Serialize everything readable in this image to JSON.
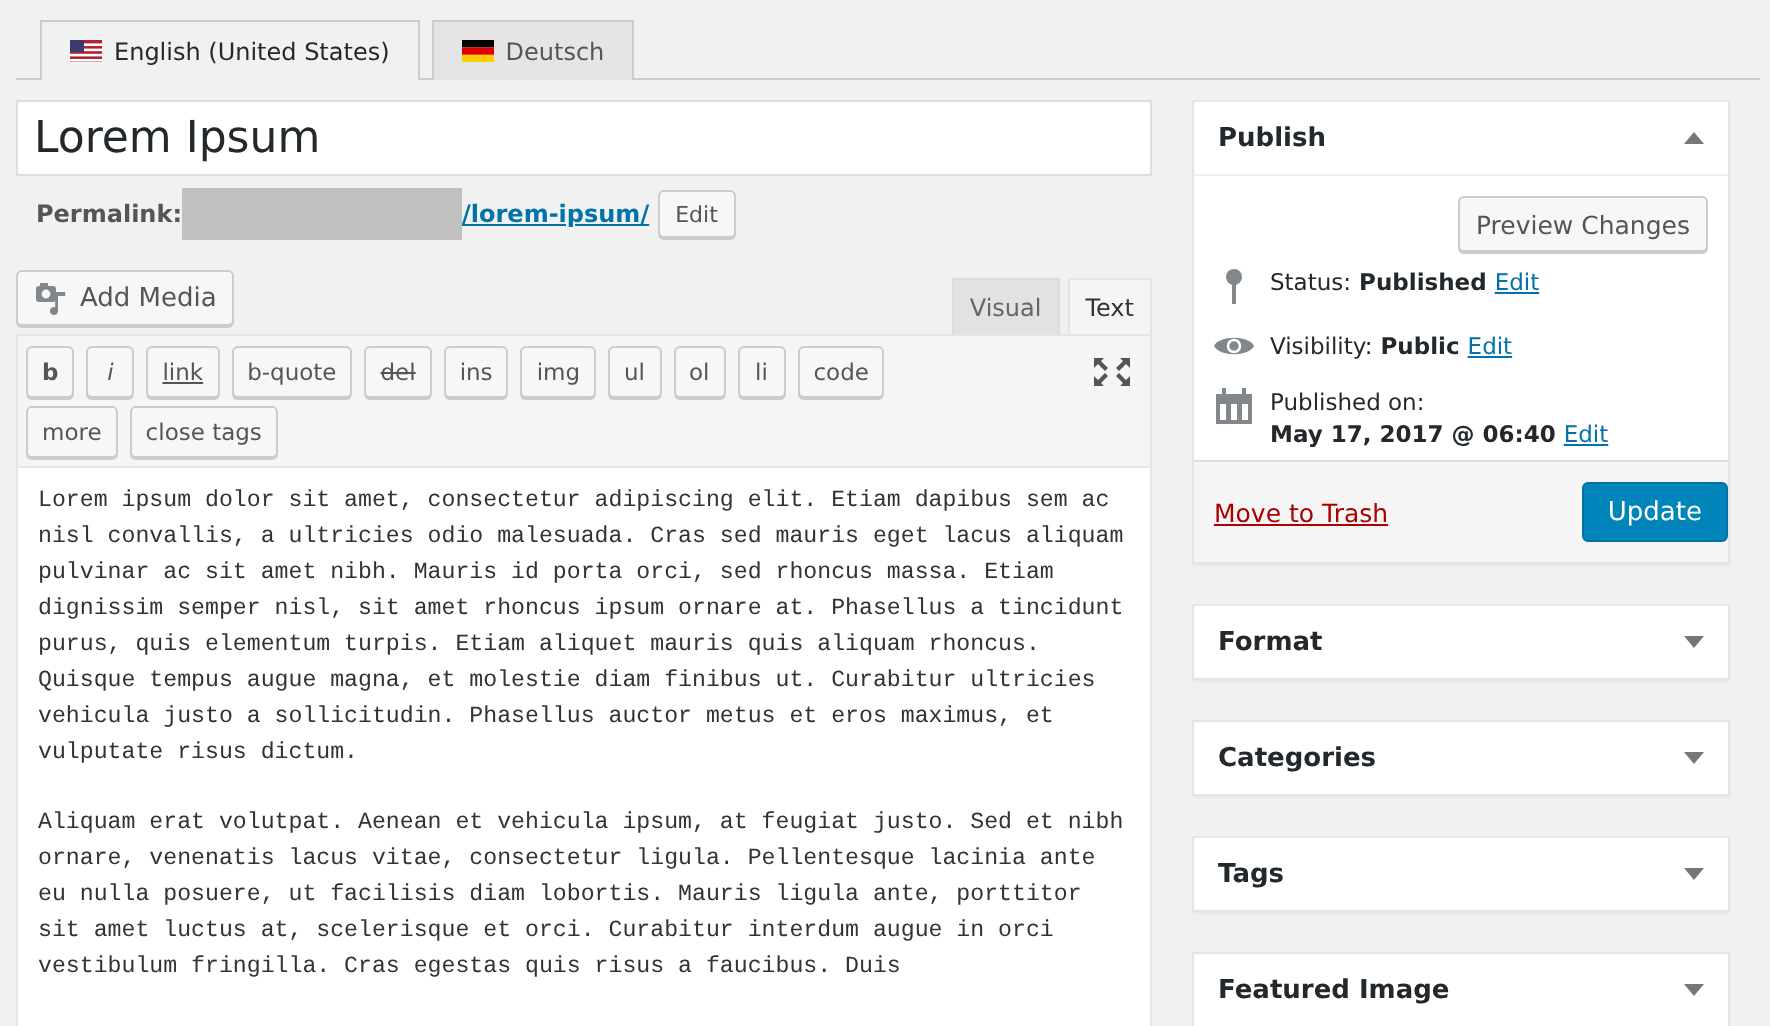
{
  "language_tabs": [
    {
      "label": "English (United States)",
      "kind": "us",
      "selected": true
    },
    {
      "label": "Deutsch",
      "kind": "de",
      "selected": false
    }
  ],
  "title_field": {
    "value": "Lorem Ipsum"
  },
  "permalink": {
    "label": "Permalink:",
    "slug": "/lorem-ipsum/",
    "edit": "Edit"
  },
  "add_media": "Add Media",
  "editor_tabs": [
    {
      "label": "Visual",
      "selected": false
    },
    {
      "label": "Text",
      "selected": true
    }
  ],
  "quicktags": [
    {
      "label": "b",
      "kind": "bold"
    },
    {
      "label": "i",
      "kind": "italic"
    },
    {
      "label": "link",
      "kind": "underline"
    },
    {
      "label": "b-quote",
      "kind": "plain"
    },
    {
      "label": "del",
      "kind": "strike"
    },
    {
      "label": "ins",
      "kind": "plain"
    },
    {
      "label": "img",
      "kind": "plain"
    },
    {
      "label": "ul",
      "kind": "plain"
    },
    {
      "label": "ol",
      "kind": "plain"
    },
    {
      "label": "li",
      "kind": "plain"
    },
    {
      "label": "code",
      "kind": "plain"
    },
    {
      "label": "more",
      "kind": "plain"
    },
    {
      "label": "close tags",
      "kind": "plain"
    }
  ],
  "content": [
    "Lorem ipsum dolor sit amet, consectetur adipiscing elit. Etiam dapibus sem ac nisl convallis, a ultricies odio malesuada. Cras sed mauris eget lacus aliquam pulvinar ac sit amet nibh. Mauris id porta orci, sed rhoncus massa. Etiam dignissim semper nisl, sit amet rhoncus ipsum ornare at. Phasellus a tincidunt purus, quis elementum turpis. Etiam aliquet mauris quis aliquam rhoncus. Quisque tempus augue magna, et molestie diam finibus ut. Curabitur ultricies vehicula justo a sollicitudin. Phasellus auctor metus et eros maximus, et vulputate risus dictum.",
    "Aliquam erat volutpat. Aenean et vehicula ipsum, at feugiat justo. Sed et nibh ornare, venenatis lacus vitae, consectetur ligula. Pellentesque lacinia ante eu nulla posuere, ut facilisis diam lobortis. Mauris ligula ante, porttitor sit amet luctus at, scelerisque et orci. Curabitur interdum augue in orci vestibulum fringilla. Cras egestas quis risus a faucibus. Duis"
  ],
  "publish": {
    "title": "Publish",
    "expanded": true,
    "preview": "Preview Changes",
    "rows": [
      {
        "kind": "pin",
        "label": "Status:",
        "value": "Published",
        "edit": "Edit"
      },
      {
        "kind": "eye",
        "label": "Visibility:",
        "value": "Public",
        "edit": "Edit"
      },
      {
        "kind": "calendar",
        "label": "Published on:",
        "value": "May 17, 2017 @ 06:40",
        "edit": "Edit"
      }
    ],
    "trash": "Move to Trash",
    "update": "Update"
  },
  "boxes": [
    {
      "title": "Format",
      "expanded": false
    },
    {
      "title": "Categories",
      "expanded": false
    },
    {
      "title": "Tags",
      "expanded": false
    },
    {
      "title": "Featured Image",
      "expanded": false
    }
  ]
}
